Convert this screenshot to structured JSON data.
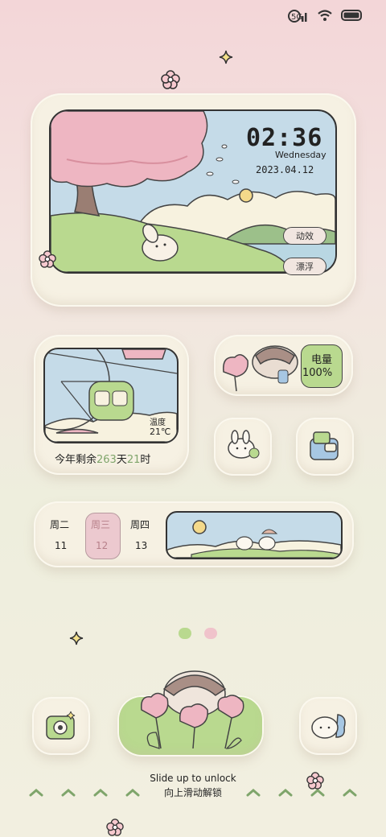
{
  "clock": {
    "time": "02:36",
    "weekday": "Wednesday",
    "date": "2023.04.12",
    "button_animation": "动效",
    "button_float": "漂浮"
  },
  "weather": {
    "label": "温度",
    "temp": "21℃",
    "countdown_prefix": "今年剩余",
    "days_left": "263",
    "days_unit": "天",
    "hours_left": "21",
    "hours_unit": "时"
  },
  "battery": {
    "label": "电量",
    "value": "100%"
  },
  "calendar": {
    "days": [
      {
        "name": "周二",
        "num": "11"
      },
      {
        "name": "周三",
        "num": "12"
      },
      {
        "name": "周四",
        "num": "13"
      }
    ]
  },
  "lock": {
    "hint_en": "Slide up to unlock",
    "hint_zh": "向上滑动解锁"
  },
  "colors": {
    "accent_green": "#7fa56b",
    "accent_pink": "#e7b9c2",
    "sky": "#c5dbe8"
  }
}
